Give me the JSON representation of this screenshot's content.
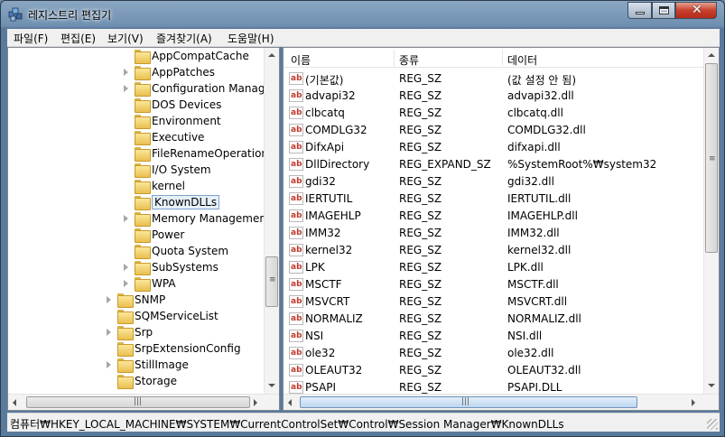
{
  "window": {
    "title": "레지스트리 편집기"
  },
  "menu": [
    "파일(F)",
    "편집(E)",
    "보기(V)",
    "즐겨찾기(A)",
    "도움말(H)"
  ],
  "tree": [
    {
      "label": "AppCompatCache",
      "expander": false,
      "level": 2,
      "selected": false
    },
    {
      "label": "AppPatches",
      "expander": true,
      "level": 2,
      "selected": false
    },
    {
      "label": "Configuration Manage",
      "expander": true,
      "level": 2,
      "selected": false
    },
    {
      "label": "DOS Devices",
      "expander": false,
      "level": 2,
      "selected": false
    },
    {
      "label": "Environment",
      "expander": false,
      "level": 2,
      "selected": false
    },
    {
      "label": "Executive",
      "expander": false,
      "level": 2,
      "selected": false
    },
    {
      "label": "FileRenameOperations",
      "expander": false,
      "level": 2,
      "selected": false
    },
    {
      "label": "I/O System",
      "expander": false,
      "level": 2,
      "selected": false
    },
    {
      "label": "kernel",
      "expander": false,
      "level": 2,
      "selected": false
    },
    {
      "label": "KnownDLLs",
      "expander": false,
      "level": 2,
      "selected": true
    },
    {
      "label": "Memory Management",
      "expander": true,
      "level": 2,
      "selected": false
    },
    {
      "label": "Power",
      "expander": false,
      "level": 2,
      "selected": false
    },
    {
      "label": "Quota System",
      "expander": false,
      "level": 2,
      "selected": false
    },
    {
      "label": "SubSystems",
      "expander": true,
      "level": 2,
      "selected": false
    },
    {
      "label": "WPA",
      "expander": true,
      "level": 2,
      "selected": false
    },
    {
      "label": "SNMP",
      "expander": true,
      "level": 1,
      "selected": false
    },
    {
      "label": "SQMServiceList",
      "expander": false,
      "level": 1,
      "selected": false
    },
    {
      "label": "Srp",
      "expander": true,
      "level": 1,
      "selected": false
    },
    {
      "label": "SrpExtensionConfig",
      "expander": false,
      "level": 1,
      "selected": false
    },
    {
      "label": "StillImage",
      "expander": true,
      "level": 1,
      "selected": false
    },
    {
      "label": "Storage",
      "expander": false,
      "level": 1,
      "selected": false
    }
  ],
  "columns": {
    "name": "이름",
    "type": "종류",
    "data": "데이터"
  },
  "values": [
    {
      "name": "(기본값)",
      "type": "REG_SZ",
      "data": "(값 설정 안 됨)"
    },
    {
      "name": "advapi32",
      "type": "REG_SZ",
      "data": "advapi32.dll"
    },
    {
      "name": "clbcatq",
      "type": "REG_SZ",
      "data": "clbcatq.dll"
    },
    {
      "name": "COMDLG32",
      "type": "REG_SZ",
      "data": "COMDLG32.dll"
    },
    {
      "name": "DifxApi",
      "type": "REG_SZ",
      "data": "difxapi.dll"
    },
    {
      "name": "DllDirectory",
      "type": "REG_EXPAND_SZ",
      "data": "%SystemRoot%₩system32"
    },
    {
      "name": "gdi32",
      "type": "REG_SZ",
      "data": "gdi32.dll"
    },
    {
      "name": "IERTUTIL",
      "type": "REG_SZ",
      "data": "IERTUTIL.dll"
    },
    {
      "name": "IMAGEHLP",
      "type": "REG_SZ",
      "data": "IMAGEHLP.dll"
    },
    {
      "name": "IMM32",
      "type": "REG_SZ",
      "data": "IMM32.dll"
    },
    {
      "name": "kernel32",
      "type": "REG_SZ",
      "data": "kernel32.dll"
    },
    {
      "name": "LPK",
      "type": "REG_SZ",
      "data": "LPK.dll"
    },
    {
      "name": "MSCTF",
      "type": "REG_SZ",
      "data": "MSCTF.dll"
    },
    {
      "name": "MSVCRT",
      "type": "REG_SZ",
      "data": "MSVCRT.dll"
    },
    {
      "name": "NORMALIZ",
      "type": "REG_SZ",
      "data": "NORMALIZ.dll"
    },
    {
      "name": "NSI",
      "type": "REG_SZ",
      "data": "NSI.dll"
    },
    {
      "name": "ole32",
      "type": "REG_SZ",
      "data": "ole32.dll"
    },
    {
      "name": "OLEAUT32",
      "type": "REG_SZ",
      "data": "OLEAUT32.dll"
    },
    {
      "name": "PSAPI",
      "type": "REG_SZ",
      "data": "PSAPI.DLL"
    }
  ],
  "value_icon_text": "ab",
  "status": {
    "path": "컴퓨터₩HKEY_LOCAL_MACHINE₩SYSTEM₩CurrentControlSet₩Control₩Session Manager₩KnownDLLs"
  }
}
